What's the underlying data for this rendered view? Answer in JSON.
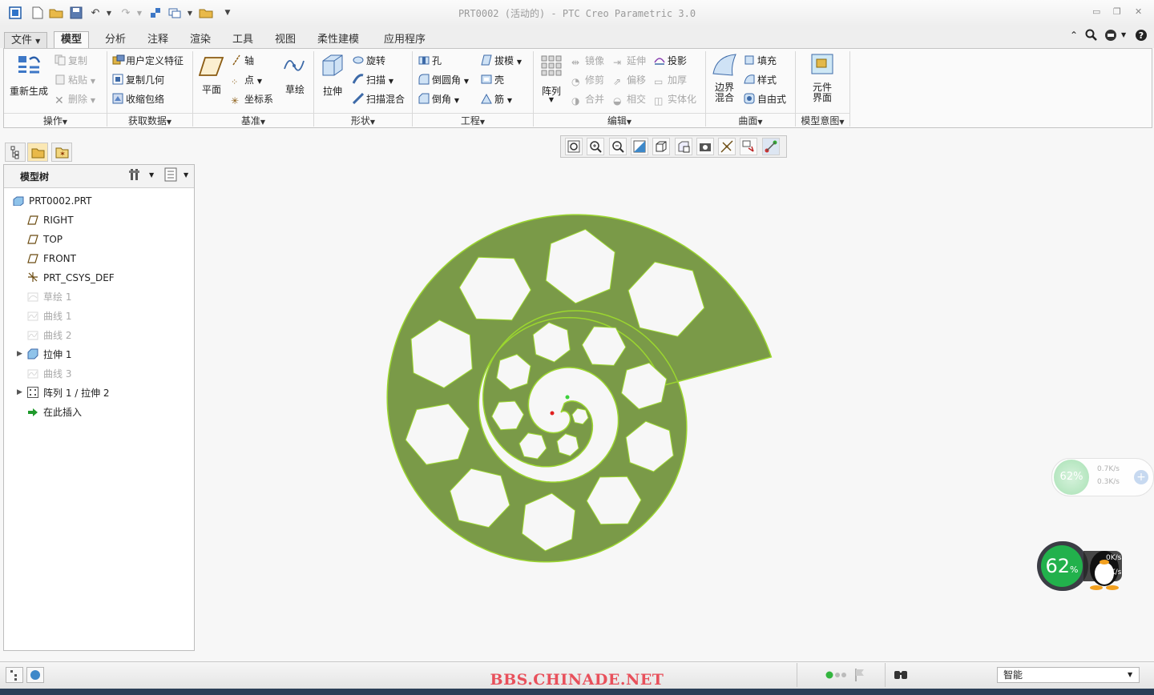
{
  "app": {
    "title": "PRT0002 (活动的) - PTC Creo Parametric 3.0"
  },
  "tabs": [
    {
      "label": "文件",
      "kind": "file"
    },
    {
      "label": "模型",
      "kind": "active"
    },
    {
      "label": "分析"
    },
    {
      "label": "注释"
    },
    {
      "label": "渲染"
    },
    {
      "label": "工具"
    },
    {
      "label": "视图"
    },
    {
      "label": "柔性建模"
    },
    {
      "label": "应用程序"
    }
  ],
  "ribbon": {
    "operations": {
      "regenerate": "重新生成",
      "copy": "复制",
      "paste": "粘贴",
      "delete": "删除",
      "group": "操作"
    },
    "get_data": {
      "udf": "用户定义特征",
      "copy_geom": "复制几何",
      "shrinkwrap": "收缩包络",
      "group": "获取数据"
    },
    "datum": {
      "plane": "平面",
      "axis": "轴",
      "point": "点",
      "csys": "坐标系",
      "sketch": "草绘",
      "group": "基准"
    },
    "shapes": {
      "extrude": "拉伸",
      "revolve": "旋转",
      "sweep": "扫描",
      "swept_blend": "扫描混合",
      "group": "形状"
    },
    "engineering": {
      "hole": "孔",
      "round": "倒圆角",
      "chamfer": "倒角",
      "draft": "拔模",
      "shell": "壳",
      "rib": "筋",
      "group": "工程"
    },
    "editing": {
      "pattern": "阵列",
      "mirror": "镜像",
      "trim": "修剪",
      "merge": "合并",
      "extend": "延伸",
      "offset": "偏移",
      "intersect": "相交",
      "project": "投影",
      "thicken": "加厚",
      "solidify": "实体化",
      "group": "编辑"
    },
    "surfaces": {
      "boundary_blend_1": "边界",
      "boundary_blend_2": "混合",
      "fill": "填充",
      "style": "样式",
      "freestyle": "自由式",
      "group": "曲面"
    },
    "model_intent": {
      "component_interface_1": "元件",
      "component_interface_2": "界面",
      "group": "模型意图"
    }
  },
  "model_tree": {
    "title": "模型树",
    "nodes": [
      {
        "label": "PRT0002.PRT",
        "icon": "part-icon",
        "dim": false,
        "expandable": false
      },
      {
        "label": "RIGHT",
        "icon": "datum-plane-icon",
        "dim": false,
        "expandable": false
      },
      {
        "label": "TOP",
        "icon": "datum-plane-icon",
        "dim": false,
        "expandable": false
      },
      {
        "label": "FRONT",
        "icon": "datum-plane-icon",
        "dim": false,
        "expandable": false
      },
      {
        "label": "PRT_CSYS_DEF",
        "icon": "csys-icon",
        "dim": false,
        "expandable": false
      },
      {
        "label": "草绘 1",
        "icon": "sketch-icon",
        "dim": true,
        "expandable": false
      },
      {
        "label": "曲线 1",
        "icon": "curve-icon",
        "dim": true,
        "expandable": false
      },
      {
        "label": "曲线 2",
        "icon": "curve-icon",
        "dim": true,
        "expandable": false
      },
      {
        "label": "拉伸 1",
        "icon": "extrude-icon",
        "dim": false,
        "expandable": true
      },
      {
        "label": "曲线 3",
        "icon": "curve-icon",
        "dim": true,
        "expandable": false
      },
      {
        "label": "阵列 1 / 拉伸 2",
        "icon": "pattern-icon",
        "dim": false,
        "expandable": true
      },
      {
        "label": "在此插入",
        "icon": "insert-here-icon",
        "dim": false,
        "expandable": false
      }
    ]
  },
  "net_widget_small": {
    "percent": "62%",
    "up": "0.7K/s",
    "down": "0.3K/s"
  },
  "net_widget_large": {
    "percent": "62",
    "unit": "%",
    "up": "0K/s",
    "down": "0K/s"
  },
  "status": {
    "watermark": "BBS.CHINADE.NET",
    "filter": "智能"
  },
  "colors": {
    "model_fill": "#7a9a48",
    "model_edge": "#9bd62f",
    "ribbon_bg": "#fafafa",
    "watermark": "#e8505b"
  }
}
